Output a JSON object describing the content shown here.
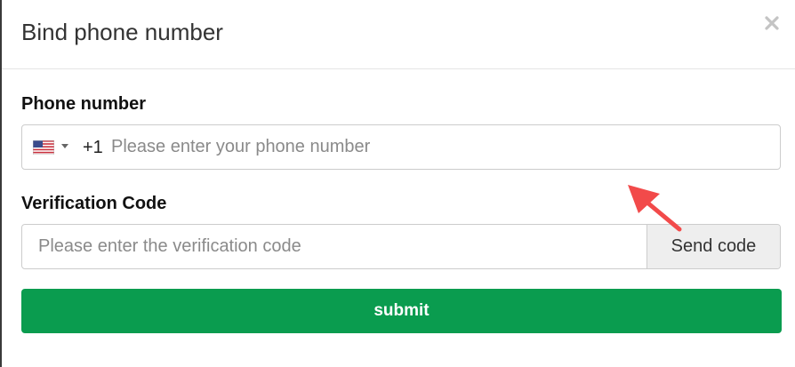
{
  "modal": {
    "title": "Bind phone number",
    "close_icon": "close-icon"
  },
  "phone": {
    "label": "Phone number",
    "country_flag": "us-flag-icon",
    "dial_code": "+1",
    "placeholder": "Please enter your phone number",
    "value": ""
  },
  "verification": {
    "label": "Verification Code",
    "placeholder": "Please enter the verification code",
    "value": "",
    "send_label": "Send code"
  },
  "submit": {
    "label": "submit"
  },
  "colors": {
    "primary": "#0a9c4f",
    "annotation": "#f24a4a"
  }
}
